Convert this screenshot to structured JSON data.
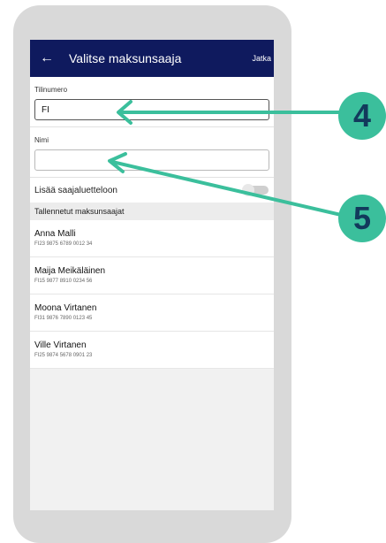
{
  "appbar": {
    "title": "Valitse maksunsaaja",
    "action_label": "Jatka",
    "back_icon": "arrow-left-icon"
  },
  "form": {
    "account_label": "Tilinumero",
    "account_value": "FI",
    "name_label": "Nimi",
    "name_value": "",
    "add_to_list_label": "Lisää saajaluetteloon",
    "add_to_list_on": false
  },
  "saved": {
    "header": "Tallennetut maksunsaajat",
    "items": [
      {
        "name": "Anna Malli",
        "iban": "FI23 9875 6789 0012 34"
      },
      {
        "name": "Maija Meikäläinen",
        "iban": "FI15 9877 8910 0234 56"
      },
      {
        "name": "Moona Virtanen",
        "iban": "FI31 9876 7890 0123 45"
      },
      {
        "name": "Ville Virtanen",
        "iban": "FI25 9874 5678 0901 23"
      }
    ]
  },
  "annotations": {
    "callout_1": "4",
    "callout_2": "5",
    "color": "#3bbf9c"
  },
  "colors": {
    "appbar": "#0f1a5e",
    "phone_frame": "#d9d9d9"
  }
}
